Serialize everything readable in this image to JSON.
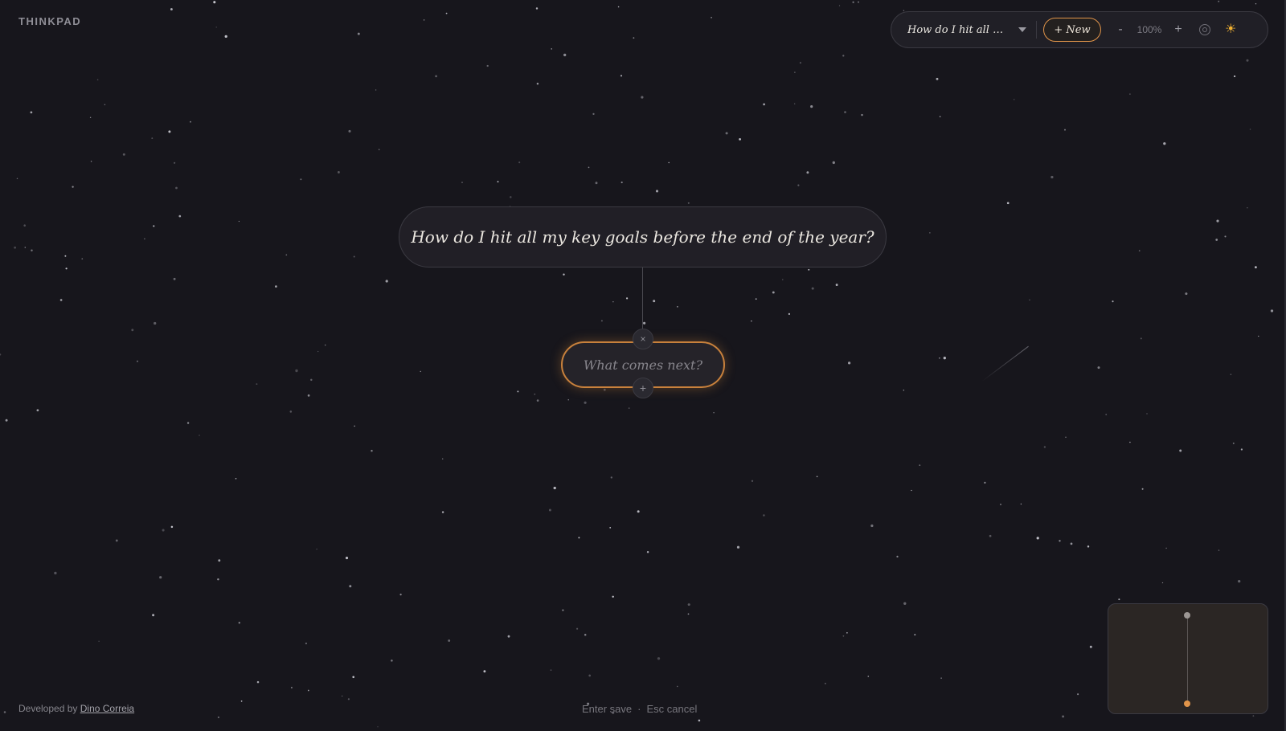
{
  "app": {
    "brand": "THINKPAD"
  },
  "toolbar": {
    "doc_title": "How do I hit all my...",
    "new_label": "+ New",
    "zoom_out": "-",
    "zoom_level": "100%",
    "zoom_in": "+",
    "recenter_icon": "target-icon",
    "theme_icon": "sun-icon",
    "theme_glyph": "☀",
    "accent": "#e0944a"
  },
  "canvas": {
    "root_node": "How do I hit all my key goals before the end of the year?",
    "edit_node": {
      "value": "",
      "placeholder": "What comes next?"
    },
    "remove_glyph": "×",
    "add_glyph": "+"
  },
  "footer": {
    "credit_prefix": "Developed by",
    "credit_name": "Dino Correia",
    "hint_save": "Enter save",
    "hint_sep": "·",
    "hint_cancel": "Esc cancel"
  }
}
